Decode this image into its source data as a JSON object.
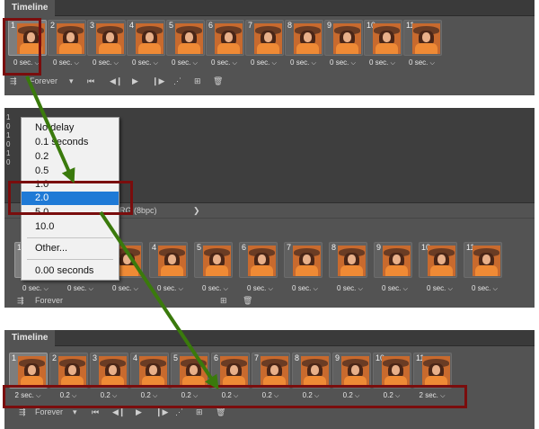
{
  "timeline_top": {
    "tab_label": "Timeline",
    "frames": [
      {
        "number": "1",
        "delay": "0 sec."
      },
      {
        "number": "2",
        "delay": "0 sec."
      },
      {
        "number": "3",
        "delay": "0 sec."
      },
      {
        "number": "4",
        "delay": "0 sec."
      },
      {
        "number": "5",
        "delay": "0 sec."
      },
      {
        "number": "6",
        "delay": "0 sec."
      },
      {
        "number": "7",
        "delay": "0 sec."
      },
      {
        "number": "8",
        "delay": "0 sec."
      },
      {
        "number": "9",
        "delay": "0 sec."
      },
      {
        "number": "10",
        "delay": "0 sec."
      },
      {
        "number": "11",
        "delay": "0 sec."
      }
    ],
    "loop_label": "Forever"
  },
  "timeline_middle": {
    "left_numbers": [
      "1",
      "0",
      "1",
      "0",
      "1",
      "0"
    ],
    "status_text": "RG (8bpc)",
    "status_chevron": "❯",
    "frames": [
      {
        "number": "1",
        "delay": "0 sec."
      },
      {
        "number": "2",
        "delay": "0 sec."
      },
      {
        "number": "3",
        "delay": "0 sec."
      },
      {
        "number": "4",
        "delay": "0 sec."
      },
      {
        "number": "5",
        "delay": "0 sec."
      },
      {
        "number": "6",
        "delay": "0 sec."
      },
      {
        "number": "7",
        "delay": "0 sec."
      },
      {
        "number": "8",
        "delay": "0 sec."
      },
      {
        "number": "9",
        "delay": "0 sec."
      },
      {
        "number": "10",
        "delay": "0 sec."
      },
      {
        "number": "11",
        "delay": "0 sec."
      }
    ],
    "loop_label": "Forever"
  },
  "delay_menu": {
    "items": [
      "No delay",
      "0.1 seconds",
      "0.2",
      "0.5",
      "1.0",
      "2.0",
      "5.0",
      "10.0"
    ],
    "selected": "2.0",
    "other": "Other...",
    "current": "0.00 seconds"
  },
  "timeline_bottom": {
    "tab_label": "Timeline",
    "frames": [
      {
        "number": "1",
        "delay": "2 sec."
      },
      {
        "number": "2",
        "delay": "0.2"
      },
      {
        "number": "3",
        "delay": "0.2"
      },
      {
        "number": "4",
        "delay": "0.2"
      },
      {
        "number": "5",
        "delay": "0.2"
      },
      {
        "number": "6",
        "delay": "0.2"
      },
      {
        "number": "7",
        "delay": "0.2"
      },
      {
        "number": "8",
        "delay": "0.2"
      },
      {
        "number": "9",
        "delay": "0.2"
      },
      {
        "number": "10",
        "delay": "0.2"
      },
      {
        "number": "11",
        "delay": "2 sec."
      }
    ],
    "loop_label": "Forever"
  },
  "icons": {
    "first_frame": "first-frame-icon",
    "prev_frame": "previous-frame-icon",
    "play": "play-icon",
    "next_frame": "next-frame-icon",
    "tween": "tween-icon",
    "new_frame": "new-frame-icon",
    "delete": "trash-icon",
    "convert": "convert-timeline-icon",
    "dropdown": "chevron-down-icon"
  },
  "colors": {
    "panel_bg": "#535353",
    "highlight_box": "#7a0d0d",
    "arrow": "#3a7a0c",
    "menu_selection": "#1f7ad6"
  }
}
